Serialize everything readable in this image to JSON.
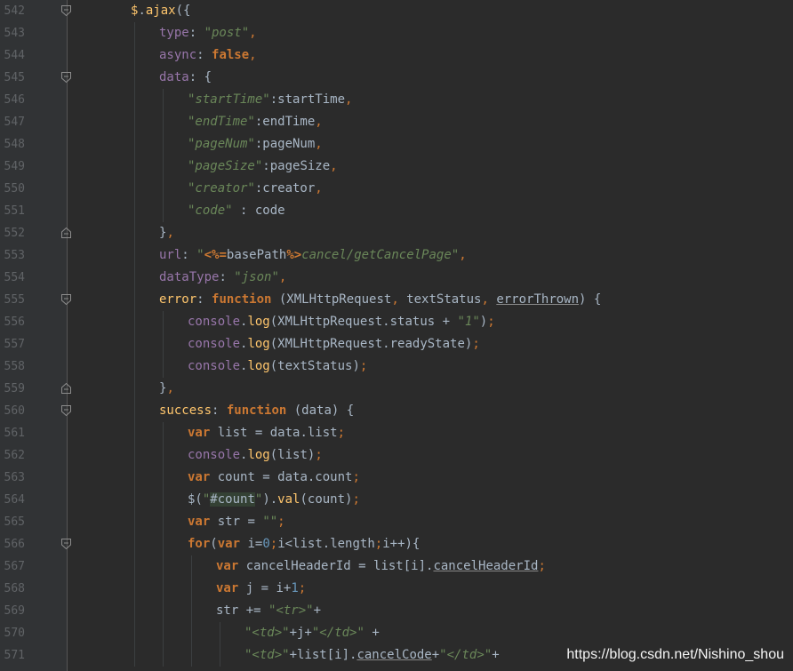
{
  "lines": [
    {
      "n": "542",
      "fold": "start",
      "indent": 1,
      "tokens": [
        [
          "$",
          "f"
        ],
        [
          ".",
          "t"
        ],
        [
          "ajax",
          "f"
        ],
        [
          "({",
          "t"
        ]
      ]
    },
    {
      "n": "543",
      "fold": "",
      "indent": 2,
      "tokens": [
        [
          "type",
          "v"
        ],
        [
          ": ",
          "t"
        ],
        [
          "\"post\"",
          "s"
        ],
        [
          ",",
          "p"
        ]
      ]
    },
    {
      "n": "544",
      "fold": "",
      "indent": 2,
      "tokens": [
        [
          "async",
          "v"
        ],
        [
          ": ",
          "t"
        ],
        [
          "false",
          "k"
        ],
        [
          ",",
          "p"
        ]
      ]
    },
    {
      "n": "545",
      "fold": "start",
      "indent": 2,
      "tokens": [
        [
          "data",
          "v"
        ],
        [
          ": {",
          "t"
        ]
      ]
    },
    {
      "n": "546",
      "fold": "",
      "indent": 3,
      "tokens": [
        [
          "\"startTime\"",
          "s"
        ],
        [
          ":startTime",
          "t"
        ],
        [
          ",",
          "p"
        ]
      ]
    },
    {
      "n": "547",
      "fold": "",
      "indent": 3,
      "tokens": [
        [
          "\"endTime\"",
          "s"
        ],
        [
          ":endTime",
          "t"
        ],
        [
          ",",
          "p"
        ]
      ]
    },
    {
      "n": "548",
      "fold": "",
      "indent": 3,
      "tokens": [
        [
          "\"pageNum\"",
          "s"
        ],
        [
          ":pageNum",
          "t"
        ],
        [
          ",",
          "p"
        ]
      ]
    },
    {
      "n": "549",
      "fold": "",
      "indent": 3,
      "tokens": [
        [
          "\"pageSize\"",
          "s"
        ],
        [
          ":pageSize",
          "t"
        ],
        [
          ",",
          "p"
        ]
      ]
    },
    {
      "n": "550",
      "fold": "",
      "indent": 3,
      "tokens": [
        [
          "\"creator\"",
          "s"
        ],
        [
          ":creator",
          "t"
        ],
        [
          ",",
          "p"
        ]
      ]
    },
    {
      "n": "551",
      "fold": "",
      "indent": 3,
      "tokens": [
        [
          "\"code\"",
          "s"
        ],
        [
          " : code",
          "t"
        ]
      ]
    },
    {
      "n": "552",
      "fold": "end",
      "indent": 2,
      "tokens": [
        [
          "}",
          "t"
        ],
        [
          ",",
          "p"
        ]
      ]
    },
    {
      "n": "553",
      "fold": "",
      "indent": 2,
      "tokens": [
        [
          "url",
          "v"
        ],
        [
          ": ",
          "t"
        ],
        [
          "\"",
          "s"
        ],
        [
          "<%=",
          "j"
        ],
        [
          "basePath",
          "t"
        ],
        [
          "%>",
          "j"
        ],
        [
          "cancel/getCancelPage\"",
          "s"
        ],
        [
          ",",
          "p"
        ]
      ]
    },
    {
      "n": "554",
      "fold": "",
      "indent": 2,
      "tokens": [
        [
          "dataType",
          "v"
        ],
        [
          ": ",
          "t"
        ],
        [
          "\"json\"",
          "s"
        ],
        [
          ",",
          "p"
        ]
      ]
    },
    {
      "n": "555",
      "fold": "start",
      "indent": 2,
      "tokens": [
        [
          "error",
          "f"
        ],
        [
          ": ",
          "t"
        ],
        [
          "function",
          "k"
        ],
        [
          " (XMLHttpRequest",
          "t"
        ],
        [
          ", ",
          "p"
        ],
        [
          "textStatus",
          "t"
        ],
        [
          ", ",
          "p"
        ],
        [
          "errorThrown",
          "u"
        ],
        [
          ") {",
          "t"
        ]
      ]
    },
    {
      "n": "556",
      "fold": "",
      "indent": 3,
      "tokens": [
        [
          "console",
          "v"
        ],
        [
          ".",
          "t"
        ],
        [
          "log",
          "f"
        ],
        [
          "(XMLHttpRequest.status + ",
          "t"
        ],
        [
          "\"1\"",
          "s"
        ],
        [
          ")",
          "t"
        ],
        [
          ";",
          "p"
        ]
      ]
    },
    {
      "n": "557",
      "fold": "",
      "indent": 3,
      "tokens": [
        [
          "console",
          "v"
        ],
        [
          ".",
          "t"
        ],
        [
          "log",
          "f"
        ],
        [
          "(XMLHttpRequest.readyState)",
          "t"
        ],
        [
          ";",
          "p"
        ]
      ]
    },
    {
      "n": "558",
      "fold": "",
      "indent": 3,
      "tokens": [
        [
          "console",
          "v"
        ],
        [
          ".",
          "t"
        ],
        [
          "log",
          "f"
        ],
        [
          "(textStatus)",
          "t"
        ],
        [
          ";",
          "p"
        ]
      ]
    },
    {
      "n": "559",
      "fold": "end",
      "indent": 2,
      "tokens": [
        [
          "}",
          "t"
        ],
        [
          ",",
          "p"
        ]
      ]
    },
    {
      "n": "560",
      "fold": "start",
      "indent": 2,
      "tokens": [
        [
          "success",
          "f"
        ],
        [
          ": ",
          "t"
        ],
        [
          "function",
          "k"
        ],
        [
          " (data) {",
          "t"
        ]
      ]
    },
    {
      "n": "561",
      "fold": "",
      "indent": 3,
      "tokens": [
        [
          "var",
          "k"
        ],
        [
          " list = data.list",
          "t"
        ],
        [
          ";",
          "p"
        ]
      ]
    },
    {
      "n": "562",
      "fold": "",
      "indent": 3,
      "tokens": [
        [
          "console",
          "v"
        ],
        [
          ".",
          "t"
        ],
        [
          "log",
          "f"
        ],
        [
          "(list)",
          "t"
        ],
        [
          ";",
          "p"
        ]
      ]
    },
    {
      "n": "563",
      "fold": "",
      "indent": 3,
      "tokens": [
        [
          "var",
          "k"
        ],
        [
          " count = data.count",
          "t"
        ],
        [
          ";",
          "p"
        ]
      ]
    },
    {
      "n": "564",
      "fold": "",
      "indent": 3,
      "tokens": [
        [
          "$(",
          "t"
        ],
        [
          "\"",
          "s"
        ],
        [
          "#count",
          "hl"
        ],
        [
          "\"",
          "s"
        ],
        [
          ").",
          "t"
        ],
        [
          "val",
          "f"
        ],
        [
          "(count)",
          "t"
        ],
        [
          ";",
          "p"
        ]
      ]
    },
    {
      "n": "565",
      "fold": "",
      "indent": 3,
      "tokens": [
        [
          "var",
          "k"
        ],
        [
          " str = ",
          "t"
        ],
        [
          "\"\"",
          "s"
        ],
        [
          ";",
          "p"
        ]
      ]
    },
    {
      "n": "566",
      "fold": "start",
      "indent": 3,
      "tokens": [
        [
          "for",
          "k"
        ],
        [
          "(",
          "t"
        ],
        [
          "var",
          "k"
        ],
        [
          " i=",
          "t"
        ],
        [
          "0",
          "n"
        ],
        [
          ";",
          "p"
        ],
        [
          "i<list.length",
          "t"
        ],
        [
          ";",
          "p"
        ],
        [
          "i++){",
          "t"
        ]
      ]
    },
    {
      "n": "567",
      "fold": "",
      "indent": 4,
      "tokens": [
        [
          "var",
          "k"
        ],
        [
          " cancelHeaderId = list[i].",
          "t"
        ],
        [
          "cancelHeaderId",
          "u"
        ],
        [
          ";",
          "p"
        ]
      ]
    },
    {
      "n": "568",
      "fold": "",
      "indent": 4,
      "tokens": [
        [
          "var",
          "k"
        ],
        [
          " j = i+",
          "t"
        ],
        [
          "1",
          "n"
        ],
        [
          ";",
          "p"
        ]
      ]
    },
    {
      "n": "569",
      "fold": "",
      "indent": 4,
      "tokens": [
        [
          "str += ",
          "t"
        ],
        [
          "\"<tr>\"",
          "s"
        ],
        [
          "+",
          "t"
        ]
      ]
    },
    {
      "n": "570",
      "fold": "",
      "indent": 5,
      "tokens": [
        [
          "\"<td>\"",
          "s"
        ],
        [
          "+j+",
          "t"
        ],
        [
          "\"</td>\"",
          "s"
        ],
        [
          " +",
          "t"
        ]
      ]
    },
    {
      "n": "571",
      "fold": "",
      "indent": 5,
      "tokens": [
        [
          "\"<td>\"",
          "s"
        ],
        [
          "+list[i].",
          "t"
        ],
        [
          "cancelCode",
          "u"
        ],
        [
          "+",
          "t"
        ],
        [
          "\"</td>\"",
          "s"
        ],
        [
          "+",
          "t"
        ]
      ]
    }
  ],
  "watermark": "https://blog.csdn.net/Nishino_shou"
}
